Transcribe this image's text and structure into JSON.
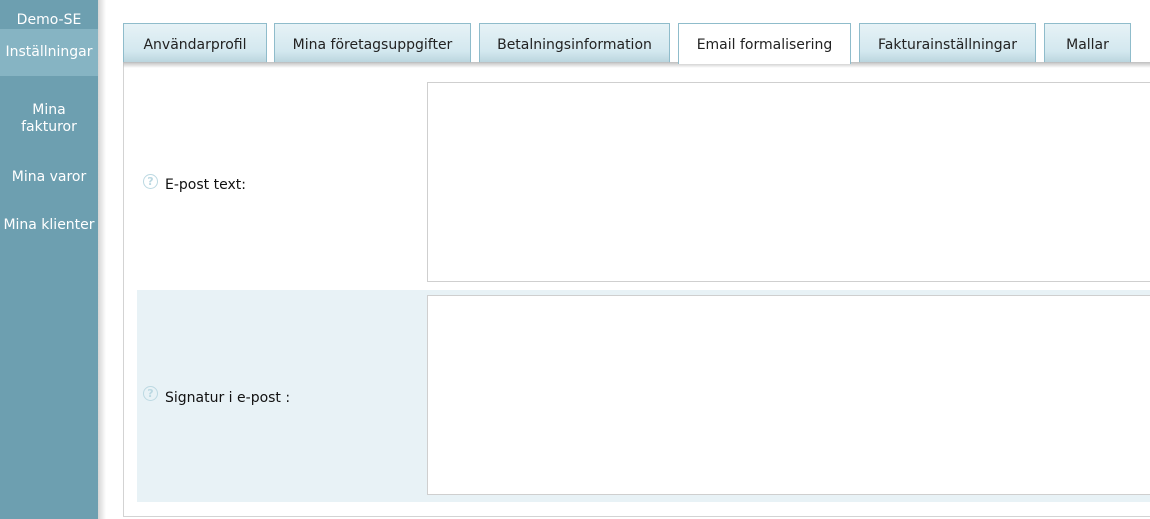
{
  "sidebar": {
    "brand": "Demo-SE",
    "items": [
      {
        "label": "Inställningar"
      },
      {
        "label": "Mina fakturor"
      },
      {
        "label": "Mina varor"
      },
      {
        "label": "Mina klienter"
      }
    ]
  },
  "tabs": [
    {
      "label": "Användarprofil"
    },
    {
      "label": "Mina företagsuppgifter"
    },
    {
      "label": "Betalningsinformation"
    },
    {
      "label": "Email formalisering"
    },
    {
      "label": "Fakturainställningar"
    },
    {
      "label": "Mallar"
    }
  ],
  "active_tab": "Email formalisering",
  "form": {
    "email_text": {
      "label": "E-post text:",
      "value": ""
    },
    "signature": {
      "label": "Signatur i e-post :",
      "value": ""
    }
  },
  "icons": {
    "help": "question-circle-icon"
  },
  "colors": {
    "sidebar": "#6d9fb0",
    "sidebar_active": "#86b4c3",
    "tab_border": "#8fbccb",
    "row_highlight": "#e8f2f6"
  }
}
